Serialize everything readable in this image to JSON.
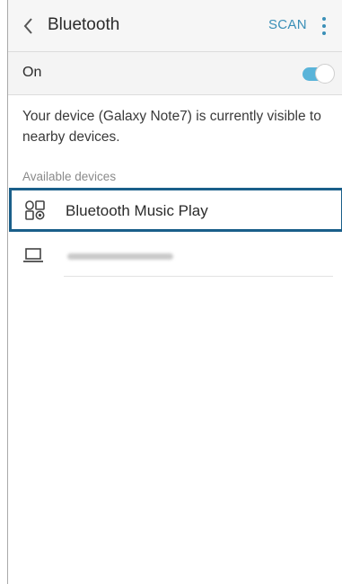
{
  "header": {
    "title": "Bluetooth",
    "scan_label": "SCAN"
  },
  "toggle": {
    "label": "On",
    "state": "on",
    "accent_color": "#5ab4d9"
  },
  "visibility_message": "Your device (Galaxy Note7) is currently visible to nearby devices.",
  "available_section": {
    "heading": "Available devices",
    "devices": [
      {
        "name": "Bluetooth Music Play",
        "icon": "audio-device-icon",
        "highlighted": true
      },
      {
        "name": "",
        "icon": "laptop-icon",
        "highlighted": false
      }
    ]
  },
  "colors": {
    "link": "#3a8fb7",
    "highlight_border": "#1a5f8a"
  }
}
